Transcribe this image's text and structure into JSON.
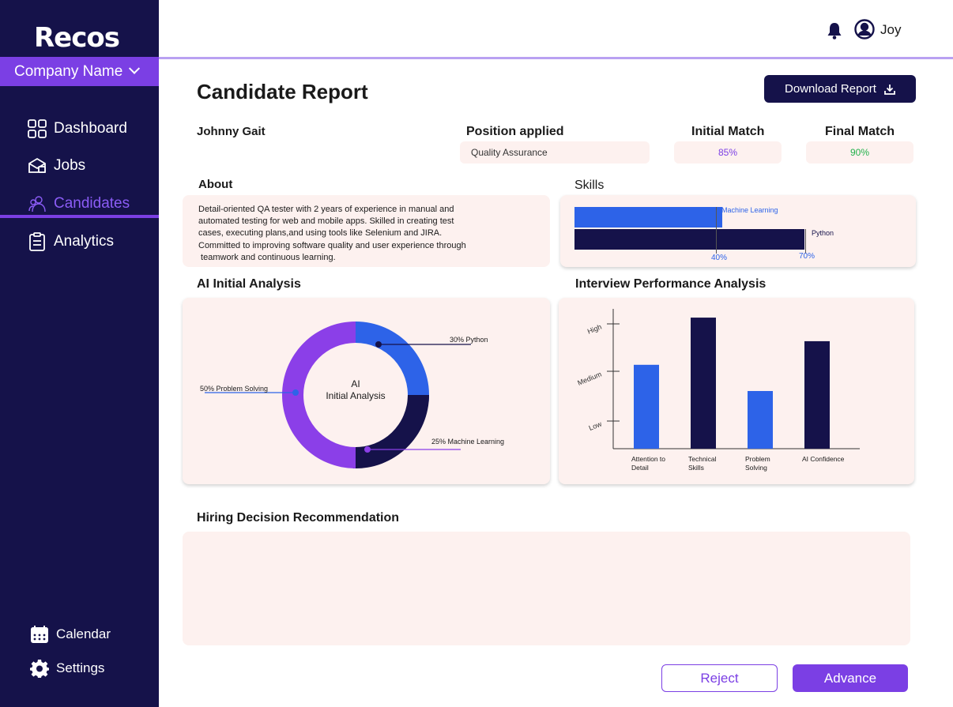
{
  "app": {
    "logo": "Recos",
    "company": "Company Name"
  },
  "sidebar": {
    "items": [
      {
        "label": "Dashboard",
        "icon": "grid-icon"
      },
      {
        "label": "Jobs",
        "icon": "briefcase-icon"
      },
      {
        "label": "Candidates",
        "icon": "candidates-icon",
        "active": true
      },
      {
        "label": "Analytics",
        "icon": "clipboard-icon"
      }
    ],
    "bottom": [
      {
        "label": "Calendar",
        "icon": "calendar-icon"
      },
      {
        "label": "Settings",
        "icon": "gear-icon"
      }
    ]
  },
  "topbar": {
    "user": "Joy"
  },
  "page": {
    "title": "Candidate Report",
    "download_label": "Download Report",
    "candidate_name": "Johnny Gait",
    "position_label": "Position applied",
    "position_value": "Quality Assurance",
    "initial_match_label": "Initial Match",
    "initial_match_value": "85%",
    "final_match_label": "Final Match",
    "final_match_value": "90%",
    "about_label": "About",
    "about_lines": [
      "Detail-oriented QA tester with 2 years of experience in manual and",
      "automated testing for web and mobile apps. Skilled in creating test",
      "cases, executing plans,and using tools like Selenium and JIRA.",
      "Committed to improving software quality and user experience through",
      " teamwork and continuous learning."
    ],
    "skills_label": "Skills",
    "ai_analysis_label": "AI Initial Analysis",
    "interview_label": "Interview Performance Analysis",
    "hiring_label": "Hiring Decision Recommendation",
    "reject_label": "Reject",
    "advance_label": "Advance"
  },
  "colors": {
    "navy": "#15124a",
    "purple": "#7b3fe4",
    "blue": "#2d63e8",
    "card": "#fdf1ef",
    "match_initial": "#7b3fe4",
    "match_final": "#22b14c"
  },
  "chart_data": [
    {
      "type": "bar",
      "orientation": "horizontal",
      "series": [
        {
          "name": "Machine Learning",
          "value": 40,
          "value_label": "40%"
        },
        {
          "name": "Python",
          "value": 70,
          "value_label": "70%"
        }
      ],
      "xlim": [
        0,
        100
      ]
    },
    {
      "type": "pie",
      "center_label": [
        "AI",
        "Initial Analysis"
      ],
      "slices": [
        {
          "label": "30% Python",
          "value": 30
        },
        {
          "label": "25% Machine Learning",
          "value": 25
        },
        {
          "label": "50% Problem Solving",
          "value": 50
        }
      ]
    },
    {
      "type": "bar",
      "categories": [
        "Attention to Detail",
        "Technical Skills",
        "Problem Solving",
        "AI Confidence"
      ],
      "values": [
        1.6,
        2.5,
        1.1,
        2.05
      ],
      "ytick_labels": [
        "Low",
        "Medium",
        "High"
      ],
      "ylim": [
        0,
        2.6
      ]
    }
  ]
}
